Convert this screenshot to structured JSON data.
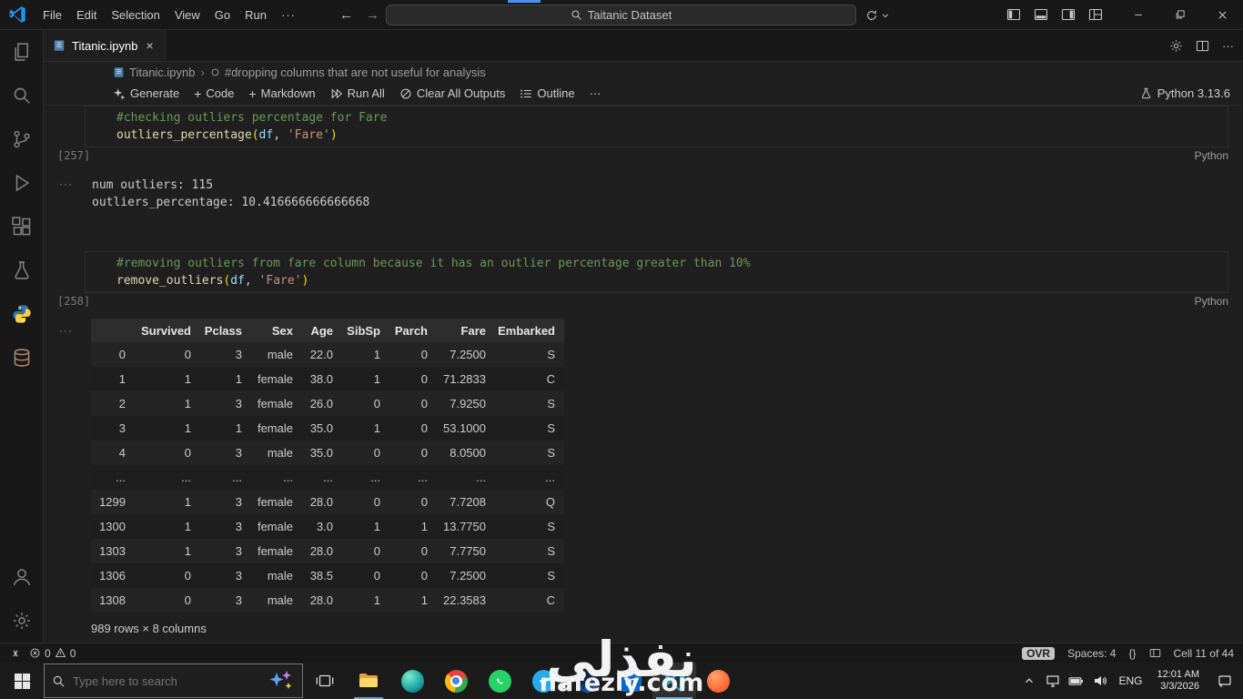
{
  "titlebar": {
    "menus": [
      "File",
      "Edit",
      "Selection",
      "View",
      "Go",
      "Run"
    ],
    "search_value": "Taitanic Dataset"
  },
  "glyphs": {
    "back": "←",
    "forward": "→",
    "ellipsis": "···",
    "plus": "+",
    "close": "×",
    "crumb_sep": "›"
  },
  "tabbar": {
    "tab_title": "Titanic.ipynb"
  },
  "breadcrumb": {
    "file": "Titanic.ipynb",
    "cell_label": "#dropping columns that are not useful for analysis"
  },
  "toolbar": {
    "generate": "Generate",
    "add_code": "Code",
    "add_markdown": "Markdown",
    "run_all": "Run All",
    "clear_all": "Clear All Outputs",
    "outline": "Outline",
    "kernel": "Python 3.13.6"
  },
  "cell1": {
    "exec_count": "[257]",
    "comment": "#checking outliers percentage for Fare",
    "fn": "outliers_percentage",
    "paren_open": "(",
    "arg_var": "df",
    "comma": ", ",
    "arg_str": "'Fare'",
    "paren_close": ")",
    "lang": "Python"
  },
  "output1": {
    "lines": [
      "num outliers: 115",
      "outliers_percentage: 10.416666666666668"
    ]
  },
  "cell2": {
    "exec_count": "[258]",
    "comment": "#removing outliers from fare column because it has an outlier percentage greater than 10%",
    "fn": "remove_outliers",
    "paren_open": "(",
    "arg_var": "df",
    "comma": ", ",
    "arg_str": "'Fare'",
    "paren_close": ")",
    "lang": "Python"
  },
  "table": {
    "headers": [
      "",
      "Survived",
      "Pclass",
      "Sex",
      "Age",
      "SibSp",
      "Parch",
      "Fare",
      "Embarked"
    ],
    "rows": [
      [
        "0",
        "0",
        "3",
        "male",
        "22.0",
        "1",
        "0",
        "7.2500",
        "S"
      ],
      [
        "1",
        "1",
        "1",
        "female",
        "38.0",
        "1",
        "0",
        "71.2833",
        "C"
      ],
      [
        "2",
        "1",
        "3",
        "female",
        "26.0",
        "0",
        "0",
        "7.9250",
        "S"
      ],
      [
        "3",
        "1",
        "1",
        "female",
        "35.0",
        "1",
        "0",
        "53.1000",
        "S"
      ],
      [
        "4",
        "0",
        "3",
        "male",
        "35.0",
        "0",
        "0",
        "8.0500",
        "S"
      ],
      [
        "...",
        "...",
        "...",
        "...",
        "...",
        "...",
        "...",
        "...",
        "..."
      ],
      [
        "1299",
        "1",
        "3",
        "female",
        "28.0",
        "0",
        "0",
        "7.7208",
        "Q"
      ],
      [
        "1300",
        "1",
        "3",
        "female",
        "3.0",
        "1",
        "1",
        "13.7750",
        "S"
      ],
      [
        "1303",
        "1",
        "3",
        "female",
        "28.0",
        "0",
        "0",
        "7.7750",
        "S"
      ],
      [
        "1306",
        "0",
        "3",
        "male",
        "38.5",
        "0",
        "0",
        "7.2500",
        "S"
      ],
      [
        "1308",
        "0",
        "3",
        "male",
        "28.0",
        "1",
        "1",
        "22.3583",
        "C"
      ]
    ],
    "footer": "989 rows × 8 columns"
  },
  "statusbar": {
    "errors": "0",
    "warnings": "0",
    "ovr": "OVR",
    "spaces": "Spaces: 4",
    "braces": "{}",
    "cell_position": "Cell 11 of 44"
  },
  "taskbar": {
    "search_placeholder": "Type here to search",
    "linkedin": "in",
    "lang": "ENG",
    "time": "12:01 AM",
    "date": "3/3/2026"
  },
  "watermark": {
    "arabic": "نفذلي",
    "latin": "nafezly.com"
  }
}
